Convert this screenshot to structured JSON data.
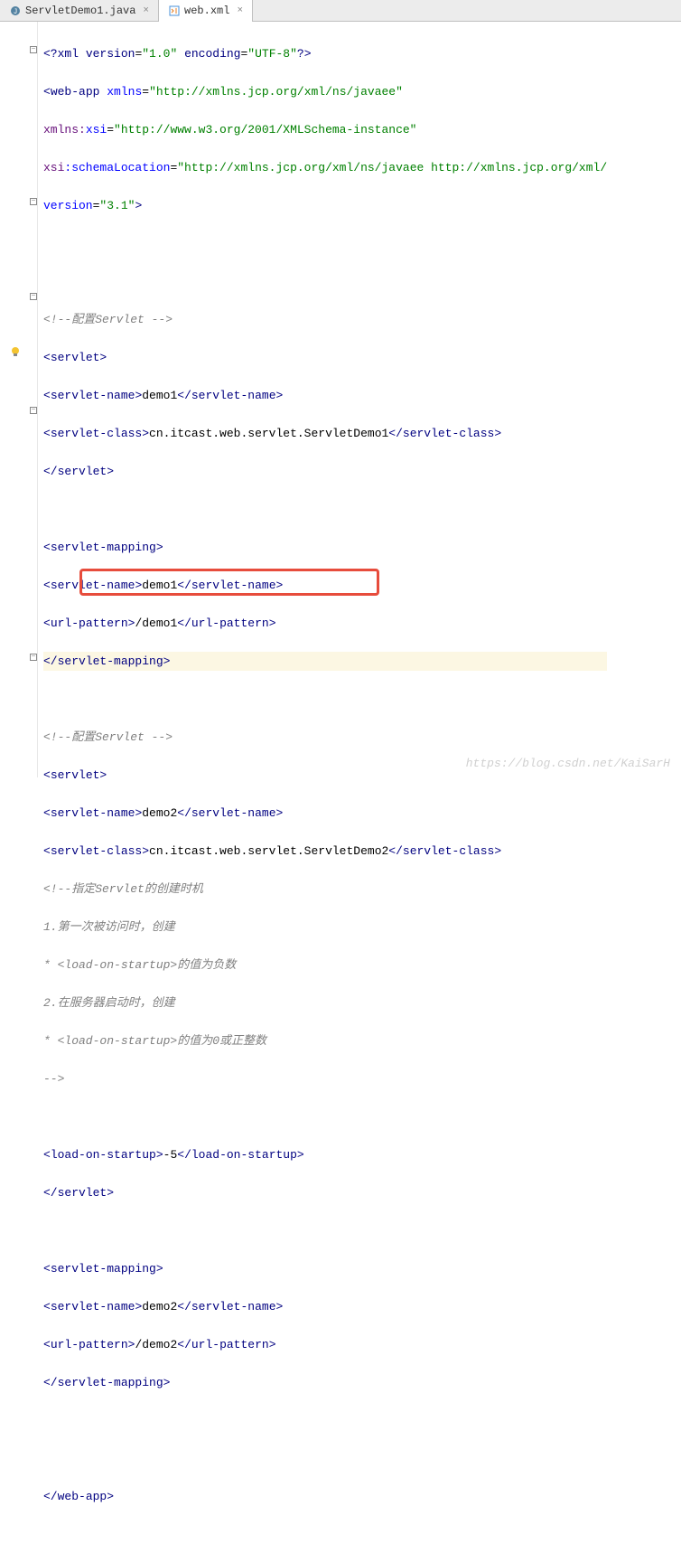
{
  "tabs": [
    {
      "label": "ServletDemo1.java",
      "icon": "java",
      "active": false
    },
    {
      "label": "web.xml",
      "icon": "xml",
      "active": true
    }
  ],
  "code": {
    "l1_pre": "<?",
    "l1_xml": "xml version",
    "l1_eq": "=",
    "l1_v1": "\"1.0\"",
    "l1_enc": " encoding",
    "l1_v2": "\"UTF-8\"",
    "l1_post": "?>",
    "l2_pre": "<",
    "l2_tag": "web-app",
    "l2_sp": " ",
    "l2_attr": "xmlns",
    "l2_val": "\"http://xmlns.jcp.org/xml/ns/javaee\"",
    "l3_ns": "xmlns:",
    "l3_xsi": "xsi",
    "l3_val": "\"http://www.w3.org/2001/XMLSchema-instance\"",
    "l4_xsi": "xsi",
    "l4_loc": ":schemaLocation",
    "l4_val": "\"http://xmlns.jcp.org/xml/ns/javaee http://xmlns.jcp.org/xml/",
    "l5_attr": "version",
    "l5_val": "\"3.1\"",
    "l5_gt": ">",
    "c1": "<!--配置Servlet -->",
    "s_open_lt": "<",
    "s_open_tag": "servlet",
    "s_open_gt": ">",
    "sn_open_lt": "<",
    "sn_tag": "servlet-name",
    "sn_gt": ">",
    "sn_v1": "demo1",
    "sn_close_lt": "</",
    "sc_open_lt": "<",
    "sc_tag": "servlet-class",
    "sc_gt": ">",
    "sc_v1": "cn.itcast.web.servlet.ServletDemo1",
    "sc_close_lt": "</",
    "s_close_lt": "</",
    "sm_tag": "servlet-mapping",
    "up_tag": "url-pattern",
    "up_v1": "/demo1",
    "sn_v2": "demo2",
    "sc_v2": "cn.itcast.web.servlet.ServletDemo2",
    "up_v2": "/demo2",
    "cmt_a": "<!--指定Servlet的创建时机",
    "cmt_b": "1.第一次被访问时，创建",
    "cmt_c": "* <load-on-startup>的值为负数",
    "cmt_d": "2.在服务器启动时，创建",
    "cmt_e": "* <load-on-startup>的值为0或正整数",
    "cmt_f": "-->",
    "los_tag": "load-on-startup",
    "los_val": "-5",
    "wa_close": "web-app"
  },
  "watermark": "https://blog.csdn.net/KaiSarH"
}
